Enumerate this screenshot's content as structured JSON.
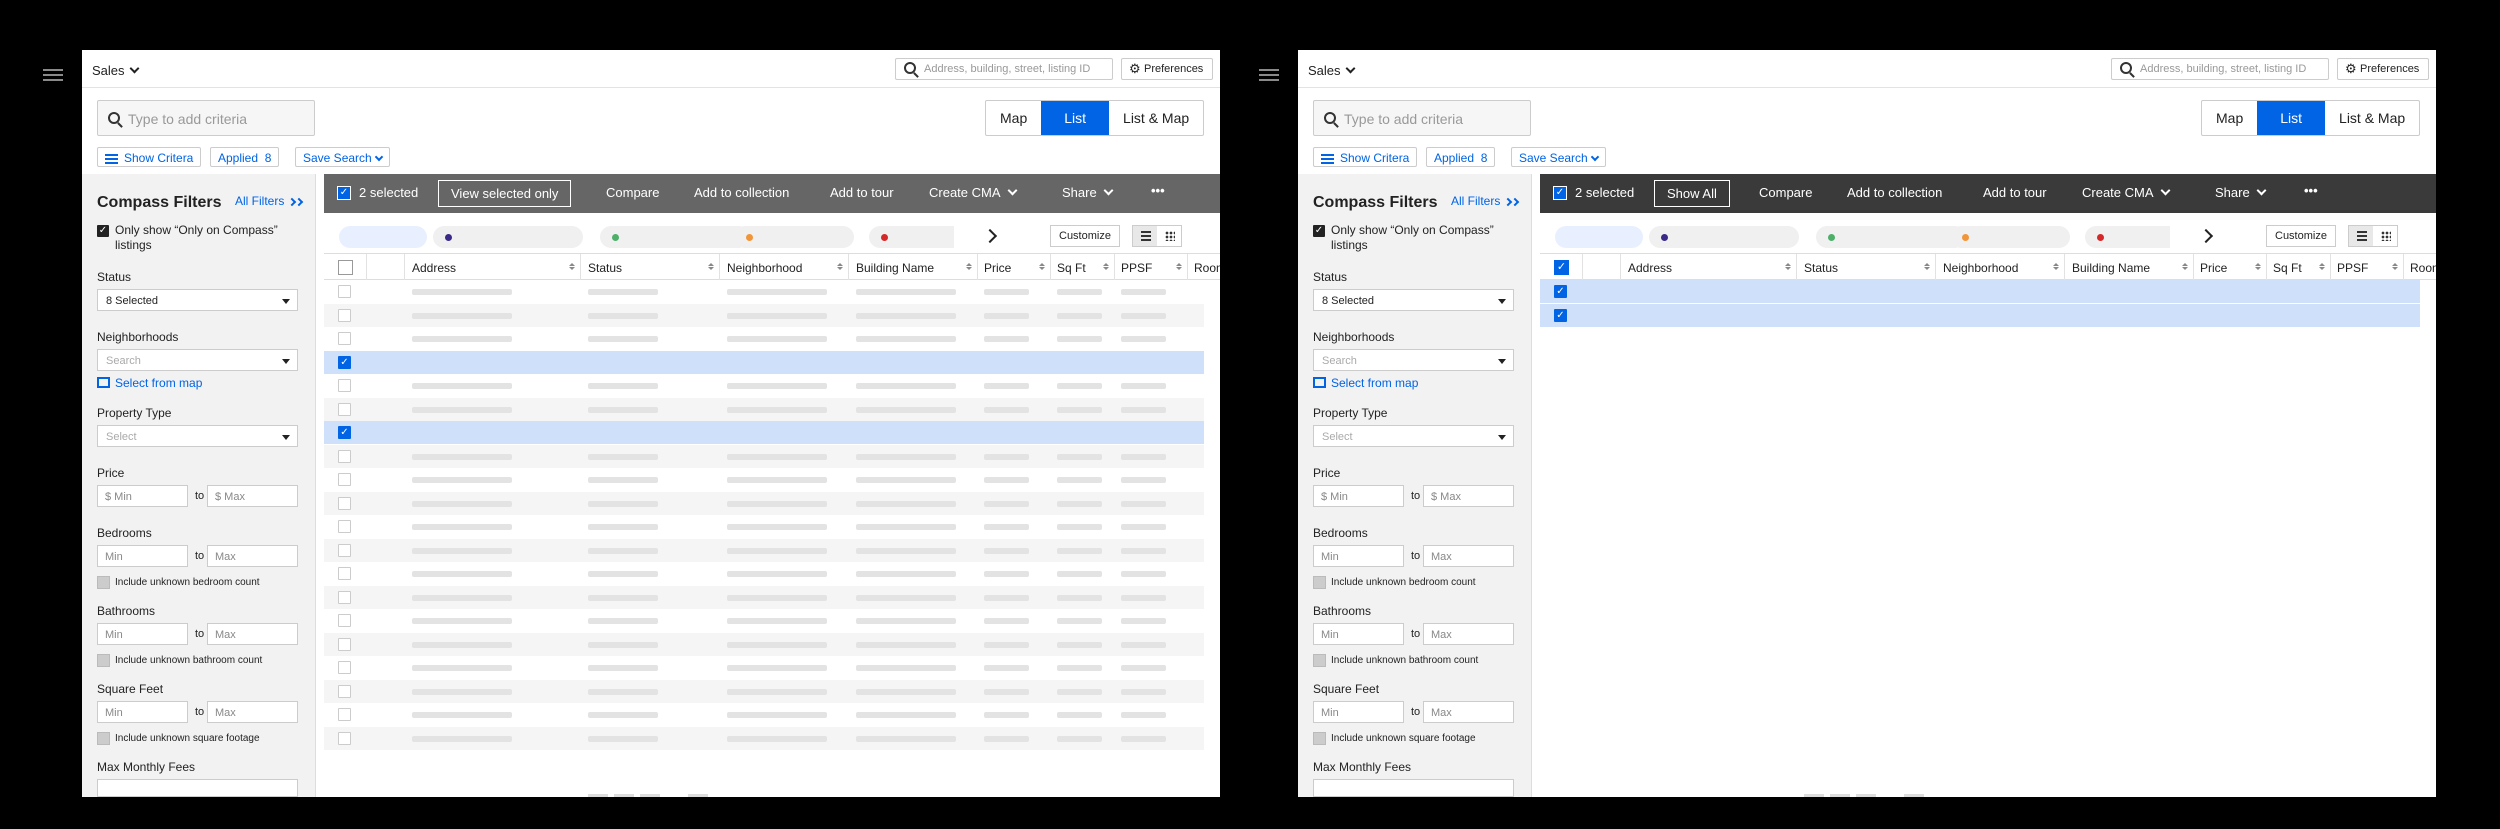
{
  "header": {
    "menu_label": "Sales",
    "search_placeholder": "Address, building, street, listing ID",
    "preferences_label": "Preferences"
  },
  "criteria": {
    "placeholder": "Type to add criteria"
  },
  "view_toggle": {
    "map": "Map",
    "list": "List",
    "list_map": "List & Map",
    "active": "List"
  },
  "subtoolbar": {
    "show_criteria": "Show Critera",
    "applied": "Applied",
    "applied_count": "8",
    "save_search": "Save Search"
  },
  "filters": {
    "title": "Compass Filters",
    "all_filters": "All Filters",
    "only_compass": "Only show “Only on Compass” listings",
    "status_label": "Status",
    "status_value": "8 Selected",
    "neighborhoods_label": "Neighborhoods",
    "neighborhoods_placeholder": "Search",
    "select_from_map": "Select from map",
    "property_type_label": "Property Type",
    "property_type_placeholder": "Select",
    "price_label": "Price",
    "price_min": "$ Min",
    "price_max": "$ Max",
    "bedrooms_label": "Bedrooms",
    "min": "Min",
    "max": "Max",
    "to": "to",
    "unknown_bedroom": "Include unknown bedroom count",
    "bathrooms_label": "Bathrooms",
    "unknown_bathroom": "Include unknown bathroom count",
    "sqft_label": "Square Feet",
    "unknown_sqft": "Include unknown square footage",
    "max_fees_label": "Max Monthly Fees"
  },
  "toolbar_left": {
    "selected": "2 selected",
    "view_selected": "View selected only",
    "compare": "Compare",
    "add_collection": "Add to collection",
    "add_tour": "Add to tour",
    "create_cma": "Create CMA",
    "share": "Share",
    "more": "•••"
  },
  "toolbar_right": {
    "selected": "2 selected",
    "show_all": "Show All",
    "compare": "Compare",
    "add_collection": "Add to collection",
    "add_tour": "Add to tour",
    "create_cma": "Create CMA",
    "share": "Share",
    "more": "•••"
  },
  "table": {
    "customize": "Customize",
    "columns": [
      "Address",
      "Status",
      "Neighborhood",
      "Building Name",
      "Price",
      "Sq Ft",
      "PPSF",
      "Rooms"
    ]
  },
  "colors": {
    "accent": "#0064e5",
    "toolbar_left_bg": "#666666",
    "toolbar_right_bg": "#3a3a3a",
    "selected_row": "#cfe0fb",
    "chip_dots": [
      "#3b2a8a",
      "#4caf6a",
      "#f0953a",
      "#d62828"
    ]
  },
  "icons": [
    "hamburger-icon",
    "search-icon",
    "gear-icon",
    "filter-bars-icon",
    "chevron-down-icon",
    "double-chevron-right-icon",
    "map-icon",
    "checkbox-icon",
    "chevron-right-icon",
    "list-view-icon",
    "grid-view-icon",
    "more-icon",
    "sort-icon"
  ]
}
